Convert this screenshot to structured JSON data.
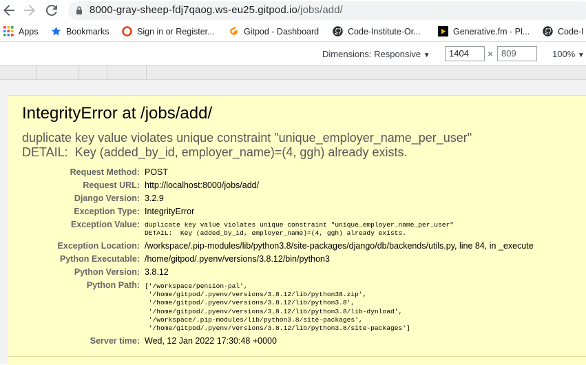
{
  "browser": {
    "url_host": "8000-gray-sheep-fdj7qaog.ws-eu25.gitpod.io",
    "url_path": "/jobs/add/",
    "bookmarks": [
      {
        "label": "Apps",
        "icon": "apps-grid-icon"
      },
      {
        "label": "Bookmarks",
        "icon": "star-icon"
      },
      {
        "label": "Sign in or Register...",
        "icon": "circle-logo-icon"
      },
      {
        "label": "Gitpod - Dashboard",
        "icon": "gitpod-icon"
      },
      {
        "label": "Code-Institute-Or...",
        "icon": "github-icon"
      },
      {
        "label": "Generative.fm - Pl...",
        "icon": "play-icon"
      },
      {
        "label": "Code-I",
        "icon": "github-icon"
      }
    ]
  },
  "devtools": {
    "dimensions_label": "Dimensions: Responsive",
    "width": "1404",
    "height": "809",
    "times": "×",
    "zoom": "100%"
  },
  "error": {
    "title": "IntegrityError at /jobs/add/",
    "message": "duplicate key value violates unique constraint \"unique_employer_name_per_user\"\nDETAIL:  Key (added_by_id, employer_name)=(4, ggh) already exists.",
    "meta": [
      {
        "label": "Request Method:",
        "value": "POST"
      },
      {
        "label": "Request URL:",
        "value": "http://localhost:8000/jobs/add/"
      },
      {
        "label": "Django Version:",
        "value": "3.2.9"
      },
      {
        "label": "Exception Type:",
        "value": "IntegrityError"
      },
      {
        "label": "Exception Value:",
        "value": "duplicate key value violates unique constraint \"unique_employer_name_per_user\"\nDETAIL:  Key (added_by_id, employer_name)=(4, ggh) already exists."
      },
      {
        "label": "Exception Location:",
        "value": "/workspace/.pip-modules/lib/python3.8/site-packages/django/db/backends/utils.py, line 84, in _execute"
      },
      {
        "label": "Python Executable:",
        "value": "/home/gitpod/.pyenv/versions/3.8.12/bin/python3"
      },
      {
        "label": "Python Version:",
        "value": "3.8.12"
      },
      {
        "label": "Python Path:",
        "value": "['/workspace/pension-pal',\n '/home/gitpod/.pyenv/versions/3.8.12/lib/python38.zip',\n '/home/gitpod/.pyenv/versions/3.8.12/lib/python3.8',\n '/home/gitpod/.pyenv/versions/3.8.12/lib/python3.8/lib-dynload',\n '/workspace/.pip-modules/lib/python3.8/site-packages',\n '/home/gitpod/.pyenv/versions/3.8.12/lib/python3.8/site-packages']"
      },
      {
        "label": "Server time:",
        "value": "Wed, 12 Jan 2022 17:30:48 +0000"
      }
    ]
  }
}
